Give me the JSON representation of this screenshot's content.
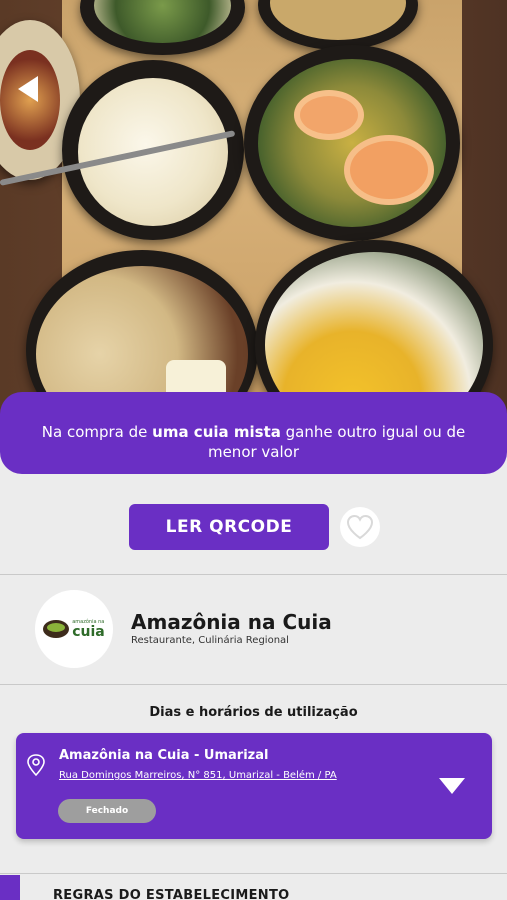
{
  "hero": {
    "back_icon": "back-arrow-icon"
  },
  "promo": {
    "text_before": "Na compra de ",
    "text_bold": "uma cuia mista",
    "text_after": " ganhe outro igual ou de menor valor"
  },
  "actions": {
    "qr_label": "LER QRCODE",
    "favorite_icon": "heart-icon"
  },
  "establishment": {
    "logo_small": "amazônia na",
    "logo_big": "cuia",
    "name": "Amazônia na Cuia",
    "categories": "Restaurante, Culinária Regional"
  },
  "schedule": {
    "title": "Dias e horários de utilização",
    "location_name": "Amazônia na Cuia - Umarizal",
    "address": "Rua Domingos Marreiros, N° 851, Umarizal - Belém / PA",
    "status": "Fechado"
  },
  "rules": {
    "title": "REGRAS DO ESTABELECIMENTO"
  },
  "colors": {
    "accent": "#6a2fc4",
    "status_gray": "#9e9e9e"
  }
}
